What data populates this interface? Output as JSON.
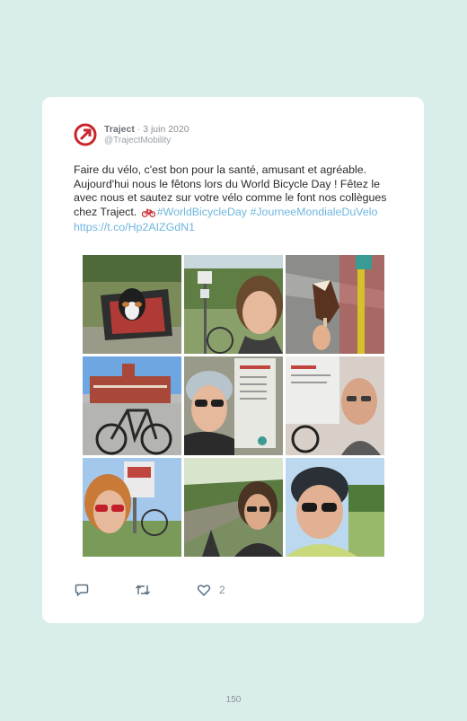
{
  "tweet": {
    "author": "Traject",
    "separator": " · ",
    "date": "3 juin 2020",
    "handle": "@TrajectMobility",
    "text": "Faire du vélo, c'est bon pour la santé, amusant et agréable. Aujourd'hui nous le fêtons lors du World Bicycle Day ! Fêtez le avec nous et sautez sur votre vélo comme le font nos collègues chez Traject.",
    "hashtag_1": "#WorldBicycleDay",
    "hashtag_2": "#JourneeMondialeDuVelo",
    "url": "https://t.co/Hp2AIZGdN1",
    "like_count": "2"
  },
  "colors": {
    "background": "#d9eeeb",
    "card": "#ffffff",
    "link": "#6eb6de",
    "brand": "#c9252c"
  },
  "icons": [
    "traject-logo-icon",
    "bicycle-emoji-icon",
    "reply-icon",
    "retweet-icon",
    "heart-icon"
  ],
  "page_number": "150"
}
